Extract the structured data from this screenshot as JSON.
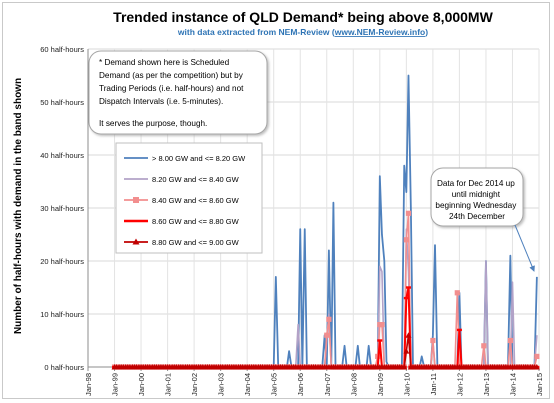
{
  "chart_data": {
    "type": "line",
    "title": "Trended instance of QLD Demand* being above 8,000MW",
    "subtitle": "with data extracted from NEM-Review (www.NEM-Review.info)",
    "subtitle_prefix": "with data extracted from NEM-Review (",
    "subtitle_link": "www.NEM-Review.info",
    "subtitle_suffix": ")",
    "ylabel": "Number of half-hours with demand in the band shown",
    "ylim": [
      0,
      60
    ],
    "y_ticks": [
      "0 half-hours",
      "10 half-hours",
      "20 half-hours",
      "30 half-hours",
      "40 half-hours",
      "50 half-hours",
      "60 half-hours"
    ],
    "x_ticks": [
      "Jan-98",
      "Jan-99",
      "Jan-00",
      "Jan-01",
      "Jan-02",
      "Jan-03",
      "Jan-04",
      "Jan-05",
      "Jan-06",
      "Jan-07",
      "Jan-08",
      "Jan-09",
      "Jan-10",
      "Jan-11",
      "Jan-12",
      "Jan-13",
      "Jan-14",
      "Jan-15"
    ],
    "xlim": [
      1998.0,
      2015.0
    ],
    "x_data_start": 1999.0,
    "grid": true,
    "legend_position": "left",
    "series": [
      {
        "name": "> 8.00 GW and <= 8.20 GW",
        "color": "#4f81bd",
        "marker": "none",
        "points": [
          [
            2005.0,
            0
          ],
          [
            2005.08,
            17
          ],
          [
            2005.17,
            0
          ],
          [
            2005.5,
            0
          ],
          [
            2005.58,
            3
          ],
          [
            2005.67,
            0
          ],
          [
            2005.92,
            0
          ],
          [
            2006.0,
            26
          ],
          [
            2006.17,
            26
          ],
          [
            2006.25,
            0
          ],
          [
            2006.83,
            0
          ],
          [
            2006.92,
            6
          ],
          [
            2007.0,
            0
          ],
          [
            2007.08,
            22
          ],
          [
            2007.17,
            0
          ],
          [
            2007.25,
            31
          ],
          [
            2007.33,
            0
          ],
          [
            2007.58,
            0
          ],
          [
            2007.67,
            4
          ],
          [
            2007.75,
            0
          ],
          [
            2008.08,
            0
          ],
          [
            2008.17,
            4
          ],
          [
            2008.25,
            0
          ],
          [
            2008.5,
            0
          ],
          [
            2008.58,
            4
          ],
          [
            2008.67,
            0
          ],
          [
            2008.92,
            0
          ],
          [
            2009.0,
            36
          ],
          [
            2009.08,
            25
          ],
          [
            2009.17,
            20
          ],
          [
            2009.25,
            1
          ],
          [
            2009.33,
            0
          ],
          [
            2009.83,
            0
          ],
          [
            2009.92,
            38
          ],
          [
            2010.0,
            33
          ],
          [
            2010.08,
            55
          ],
          [
            2010.17,
            30
          ],
          [
            2010.25,
            0
          ],
          [
            2010.5,
            0
          ],
          [
            2010.58,
            2
          ],
          [
            2010.67,
            0
          ],
          [
            2010.92,
            0
          ],
          [
            2011.0,
            6
          ],
          [
            2011.08,
            23
          ],
          [
            2011.17,
            0
          ],
          [
            2011.92,
            0
          ],
          [
            2012.0,
            14
          ],
          [
            2012.08,
            0
          ],
          [
            2012.92,
            0
          ],
          [
            2013.0,
            20
          ],
          [
            2013.08,
            0
          ],
          [
            2013.83,
            0
          ],
          [
            2013.92,
            21
          ],
          [
            2014.0,
            0
          ],
          [
            2014.83,
            0
          ],
          [
            2014.92,
            17
          ]
        ]
      },
      {
        "name": "8.20 GW and <= 8.40 GW",
        "color": "#b3a2c7",
        "marker": "none",
        "points": [
          [
            2005.83,
            0
          ],
          [
            2005.92,
            8
          ],
          [
            2006.0,
            0
          ],
          [
            2006.92,
            0
          ],
          [
            2007.0,
            5
          ],
          [
            2007.08,
            10
          ],
          [
            2007.17,
            0
          ],
          [
            2008.92,
            0
          ],
          [
            2009.0,
            19
          ],
          [
            2009.08,
            18
          ],
          [
            2009.17,
            0
          ],
          [
            2009.92,
            0
          ],
          [
            2010.0,
            26
          ],
          [
            2010.08,
            18
          ],
          [
            2010.17,
            0
          ],
          [
            2010.92,
            0
          ],
          [
            2011.0,
            5
          ],
          [
            2011.08,
            0
          ],
          [
            2012.92,
            0
          ],
          [
            2013.0,
            20
          ],
          [
            2013.08,
            0
          ],
          [
            2013.92,
            0
          ],
          [
            2014.0,
            16
          ],
          [
            2014.08,
            0
          ],
          [
            2014.83,
            0
          ],
          [
            2014.92,
            6
          ]
        ]
      },
      {
        "name": "8.40 GW and <= 8.60 GW",
        "color": "#f28e8e",
        "marker": "square",
        "points": [
          [
            2006.92,
            0
          ],
          [
            2007.0,
            6
          ],
          [
            2007.08,
            9
          ],
          [
            2007.17,
            0
          ],
          [
            2008.83,
            0
          ],
          [
            2008.92,
            2
          ],
          [
            2009.0,
            8
          ],
          [
            2009.08,
            8
          ],
          [
            2009.17,
            0
          ],
          [
            2009.92,
            0
          ],
          [
            2010.0,
            24
          ],
          [
            2010.08,
            29
          ],
          [
            2010.17,
            0
          ],
          [
            2010.92,
            0
          ],
          [
            2011.0,
            5
          ],
          [
            2011.08,
            0
          ],
          [
            2011.83,
            0
          ],
          [
            2011.92,
            14
          ],
          [
            2012.0,
            0
          ],
          [
            2012.83,
            0
          ],
          [
            2012.92,
            4
          ],
          [
            2013.0,
            0
          ],
          [
            2013.83,
            0
          ],
          [
            2013.92,
            5
          ],
          [
            2014.0,
            0
          ],
          [
            2014.83,
            0
          ],
          [
            2014.92,
            2
          ]
        ]
      },
      {
        "name": "8.60 GW and <= 8.80 GW",
        "color": "#ff0000",
        "marker": "dash",
        "points": [
          [
            2008.92,
            0
          ],
          [
            2009.0,
            5
          ],
          [
            2009.08,
            0
          ],
          [
            2009.92,
            0
          ],
          [
            2010.0,
            13
          ],
          [
            2010.08,
            15
          ],
          [
            2010.17,
            0
          ],
          [
            2011.92,
            0
          ],
          [
            2012.0,
            7
          ],
          [
            2012.08,
            0
          ]
        ]
      },
      {
        "name": "8.80 GW and <= 9.00 GW",
        "color": "#c00000",
        "marker": "triangle",
        "points": [
          [
            2009.92,
            0
          ],
          [
            2010.0,
            3
          ],
          [
            2010.08,
            6
          ],
          [
            2010.17,
            0
          ]
        ]
      }
    ]
  },
  "annotations": {
    "note_lines": [
      "*  Demand shown here is Scheduled",
      "Demand (as per the competition) but by",
      "Trading Periods (i.e. half-hours) and not",
      "Dispatch Intervals (i.e. 5-minutes).",
      "",
      "It serves the purpose, though."
    ],
    "callout_lines": [
      "Data for Dec 2014  up",
      "until midnight",
      "beginning Wednesday",
      "24th December"
    ]
  }
}
